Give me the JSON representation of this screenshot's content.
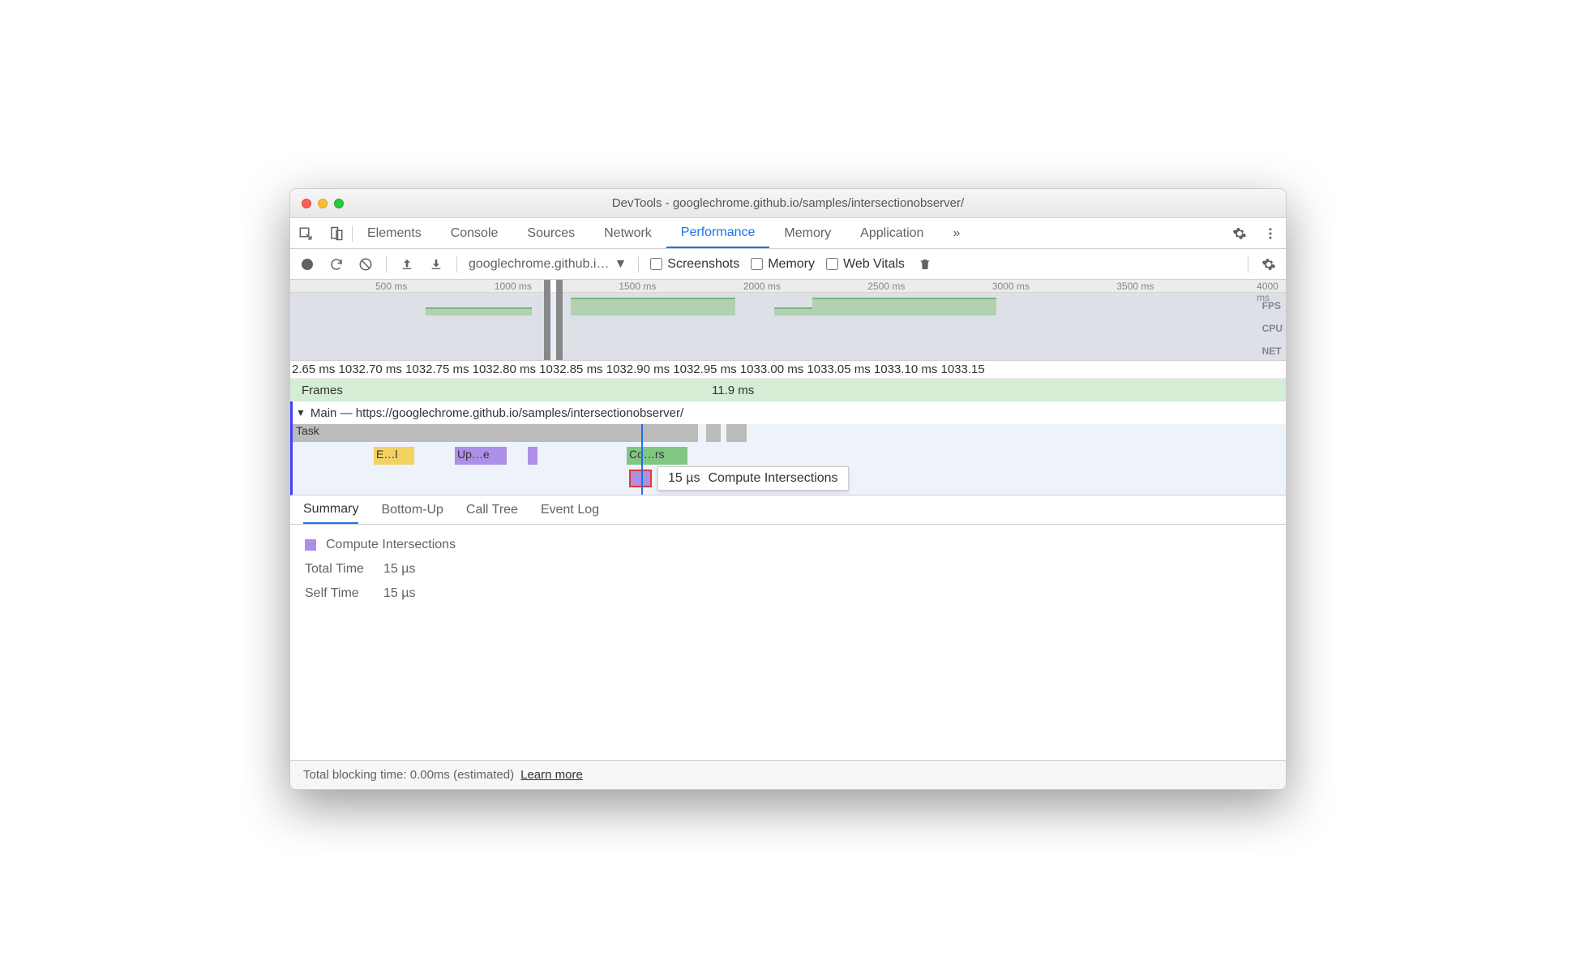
{
  "window": {
    "title": "DevTools - googlechrome.github.io/samples/intersectionobserver/"
  },
  "tabs": {
    "items": [
      "Elements",
      "Console",
      "Sources",
      "Network",
      "Performance",
      "Memory",
      "Application"
    ],
    "active": "Performance",
    "overflow": "»"
  },
  "toolbar": {
    "selector": "googlechrome.github.i…",
    "screenshots": "Screenshots",
    "memory": "Memory",
    "webvitals": "Web Vitals"
  },
  "overview": {
    "ticks": [
      "500 ms",
      "1000 ms",
      "1500 ms",
      "2000 ms",
      "2500 ms",
      "3000 ms",
      "3500 ms",
      "4000 ms"
    ],
    "labels": {
      "fps": "FPS",
      "cpu": "CPU",
      "net": "NET"
    }
  },
  "detail_ruler": "2.65 ms 1032.70 ms 1032.75 ms 1032.80 ms 1032.85 ms 1032.90 ms 1032.95 ms 1033.00 ms 1033.05 ms 1033.10 ms 1033.15",
  "frames": {
    "label": "Frames",
    "value": "11.9 ms"
  },
  "main": {
    "label": "Main — https://googlechrome.github.io/samples/intersectionobserver/"
  },
  "flame": {
    "task": "Task",
    "e1": "E…l",
    "upd": "Up…e",
    "co": "Co…rs"
  },
  "tooltip": {
    "dur": "15 µs",
    "name": "Compute Intersections"
  },
  "detail_tabs": {
    "summary": "Summary",
    "bottomup": "Bottom-Up",
    "calltree": "Call Tree",
    "eventlog": "Event Log"
  },
  "summary": {
    "name": "Compute Intersections",
    "total_label": "Total Time",
    "total_val": "15 µs",
    "self_label": "Self Time",
    "self_val": "15 µs"
  },
  "footer": {
    "tbt": "Total blocking time: 0.00ms (estimated)",
    "learn": "Learn more"
  }
}
